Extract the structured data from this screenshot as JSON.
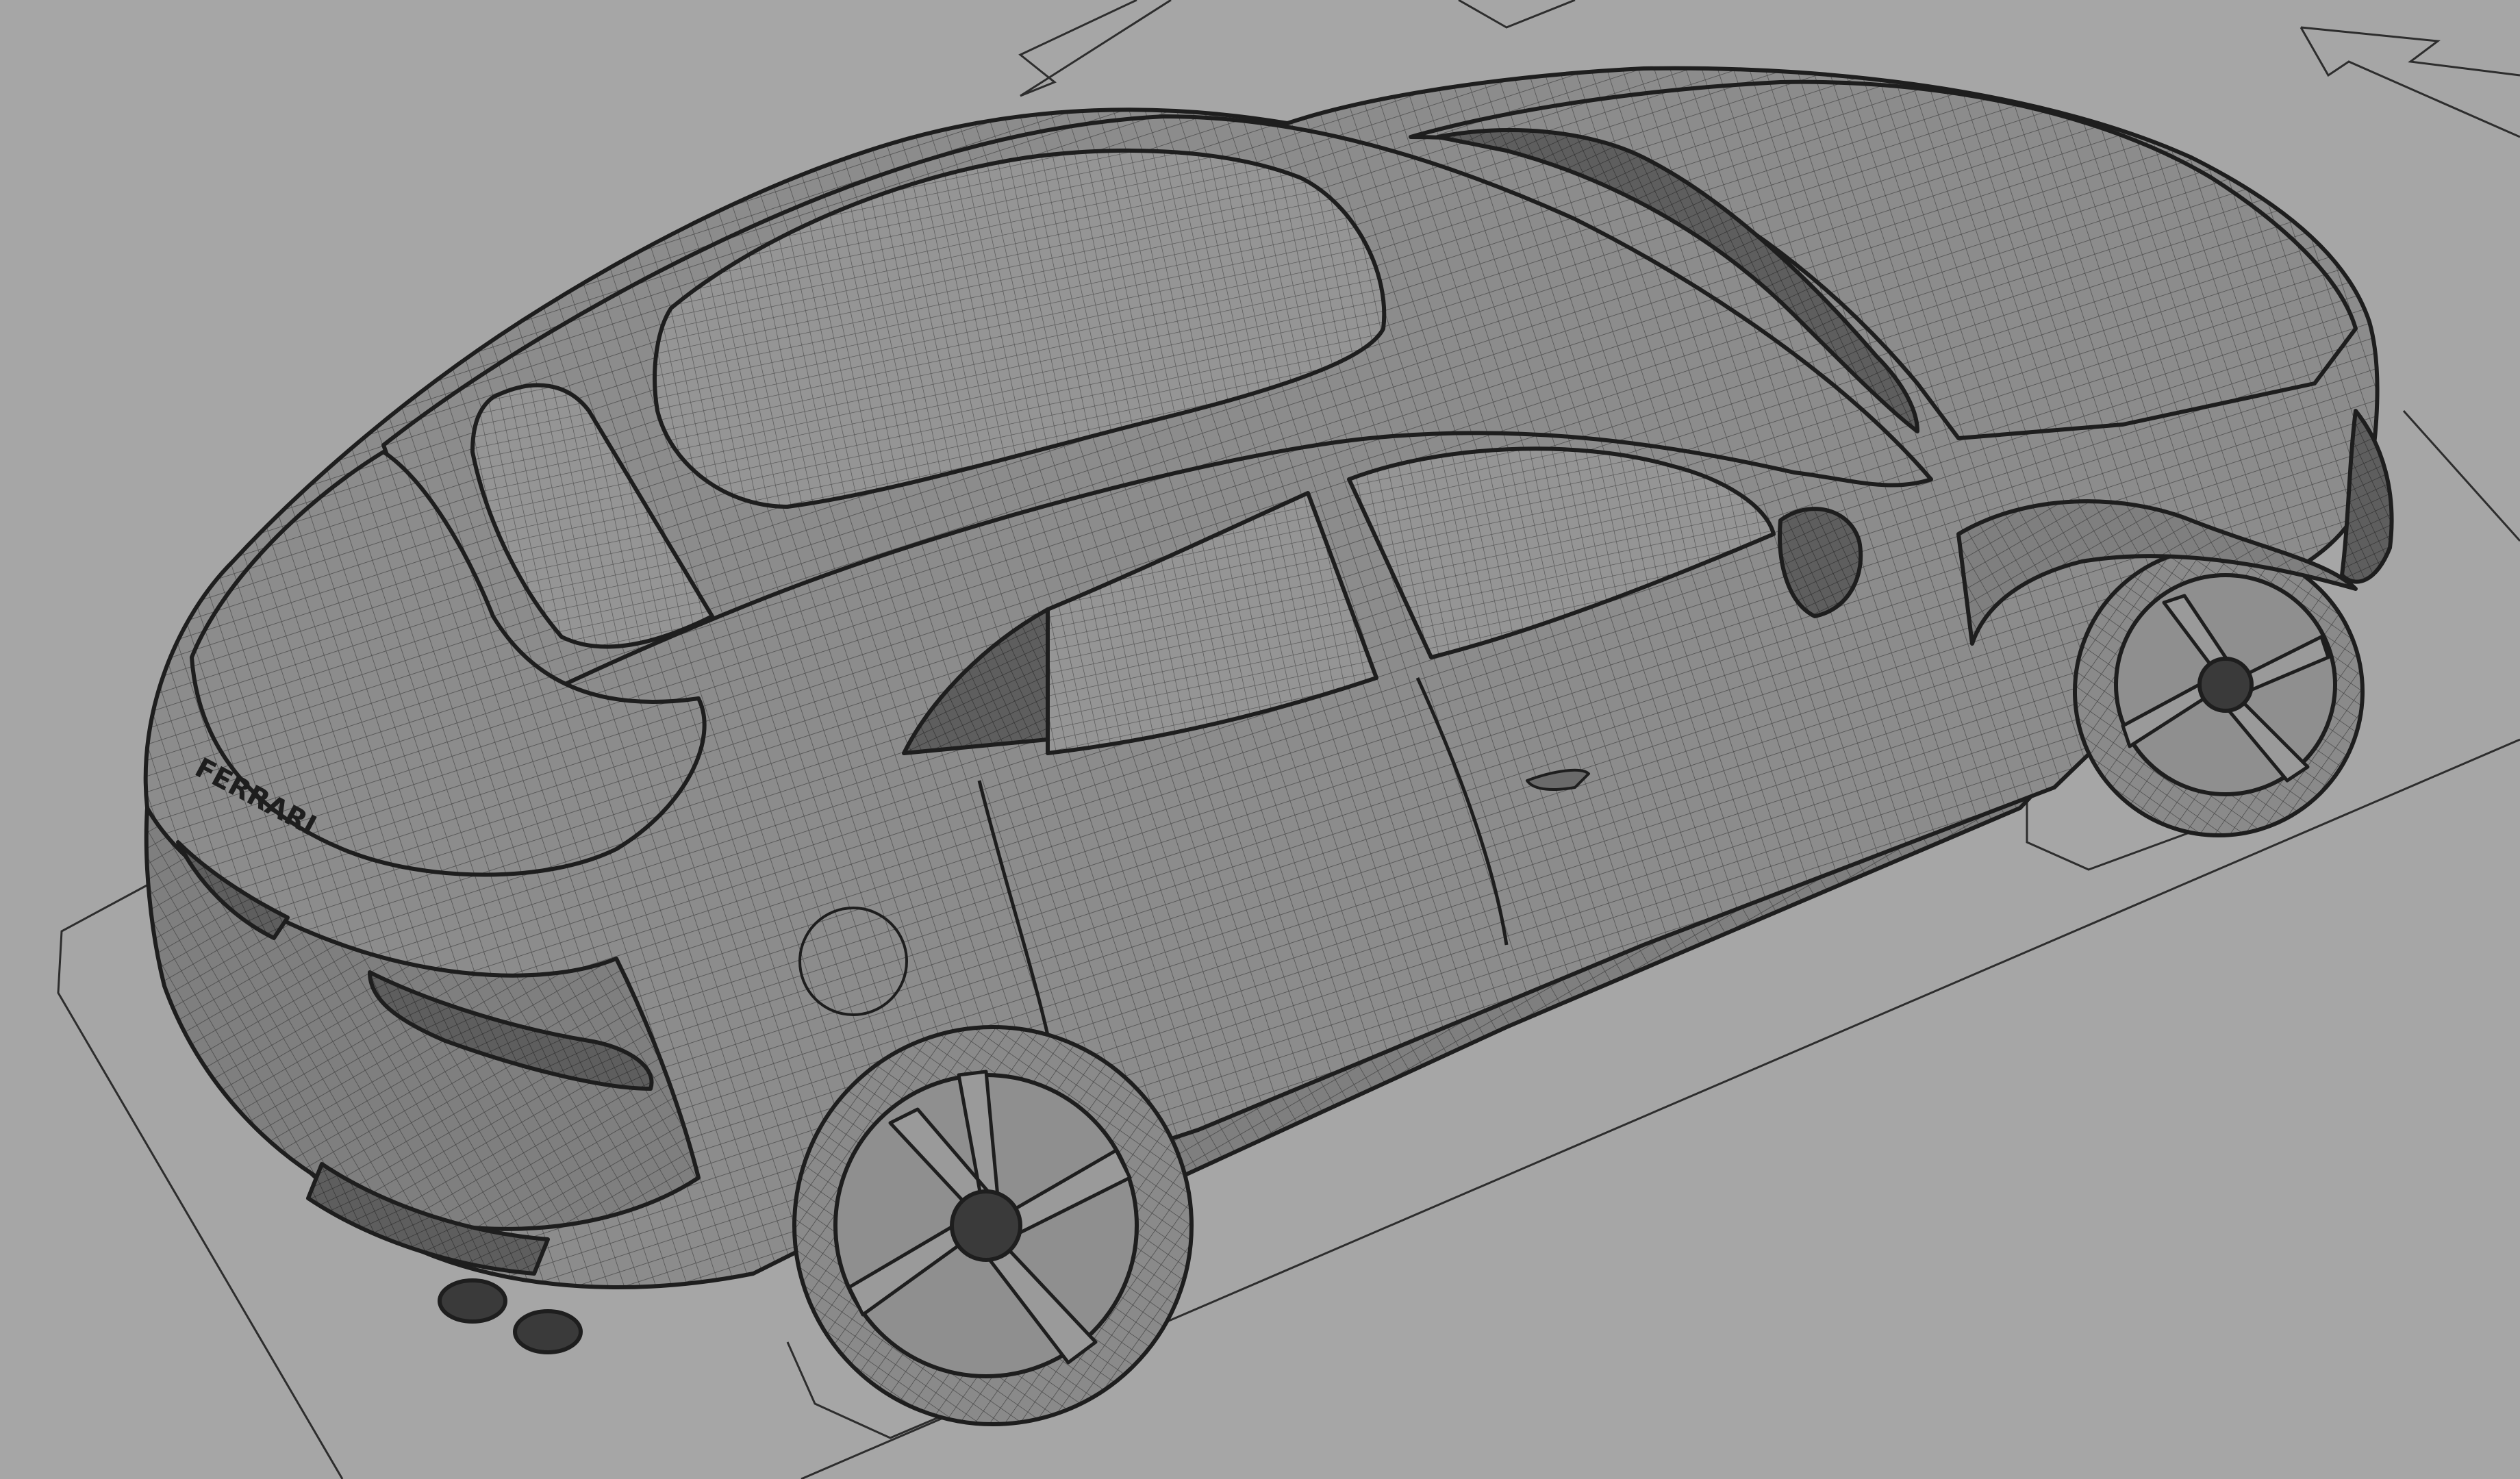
{
  "viewport": {
    "background_color": "#a6a6a6",
    "body_color": "#8c8c8c",
    "body_shade_color": "#7d7d7d",
    "glass_color": "#939393",
    "mesh_line_color": "#4a4a4a",
    "outline_color": "#1e1e1e",
    "ground_line_color": "#2d2d2d"
  },
  "badge": {
    "text": "FERRARI"
  }
}
